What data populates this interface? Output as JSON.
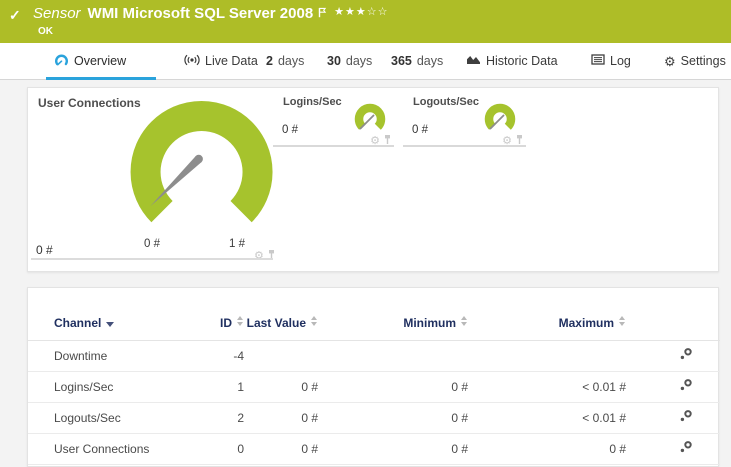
{
  "colors": {
    "header_green": "#aebd27",
    "gauge_green": "#a6c32d",
    "accent_blue": "#2aa3dc",
    "table_header_text": "#203060"
  },
  "header": {
    "check_icon": "✓",
    "kind": "Sensor",
    "title": "WMI Microsoft SQL Server 2008",
    "status": "OK",
    "rating": "★★★☆☆"
  },
  "tabs": {
    "overview": {
      "label": "Overview"
    },
    "live_data": {
      "label": "Live Data"
    },
    "d2": {
      "num": "2",
      "unit": "days"
    },
    "d30": {
      "num": "30",
      "unit": "days"
    },
    "d365": {
      "num": "365",
      "unit": "days"
    },
    "historic": {
      "label": "Historic Data"
    },
    "log": {
      "label": "Log"
    },
    "settings": {
      "label": "Settings"
    }
  },
  "icons": {
    "gear": "⚙"
  },
  "gauges": {
    "main": {
      "title": "User Connections",
      "value": "0 #",
      "scale_min": "0 #",
      "scale_max": "1 #",
      "value_num": 0,
      "range": [
        0,
        1
      ]
    },
    "logins": {
      "title": "Logins/Sec",
      "value": "0 #",
      "value_num": 0
    },
    "logouts": {
      "title": "Logouts/Sec",
      "value": "0 #",
      "value_num": 0
    }
  },
  "table": {
    "headers": {
      "channel": "Channel",
      "id": "ID",
      "last_value": "Last Value",
      "minimum": "Minimum",
      "maximum": "Maximum"
    },
    "rows": [
      {
        "channel": "Downtime",
        "id": "-4",
        "last_value": "",
        "minimum": "",
        "maximum": ""
      },
      {
        "channel": "Logins/Sec",
        "id": "1",
        "last_value": "0 #",
        "minimum": "0 #",
        "maximum": "< 0.01 #"
      },
      {
        "channel": "Logouts/Sec",
        "id": "2",
        "last_value": "0 #",
        "minimum": "0 #",
        "maximum": "< 0.01 #"
      },
      {
        "channel": "User Connections",
        "id": "0",
        "last_value": "0 #",
        "minimum": "0 #",
        "maximum": "0 #"
      }
    ]
  }
}
